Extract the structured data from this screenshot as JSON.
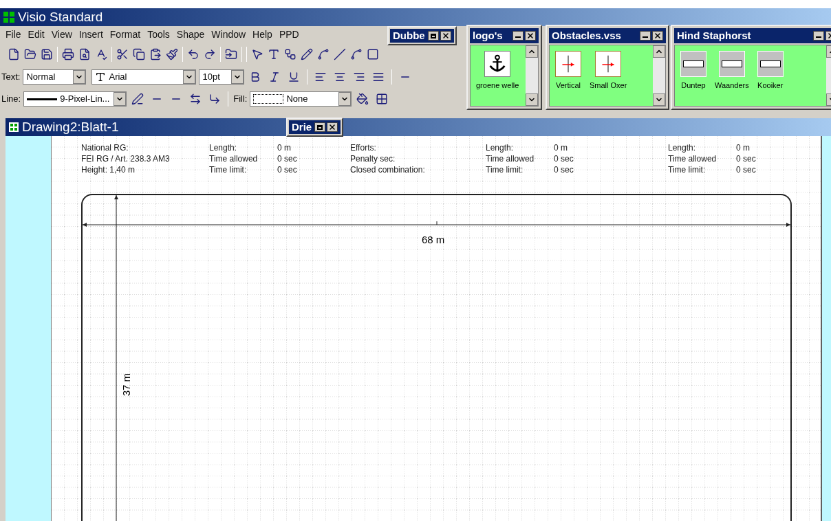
{
  "app": {
    "title": "Visio Standard"
  },
  "menu": [
    "File",
    "Edit",
    "View",
    "Insert",
    "Format",
    "Tools",
    "Shape",
    "Window",
    "Help",
    "PPD"
  ],
  "text_toolbar": {
    "label": "Text:",
    "style": "Normal",
    "font": "Arial",
    "size": "10pt"
  },
  "line_toolbar": {
    "label": "Line:",
    "line": "9-Pixel-Lin...",
    "fill_label": "Fill:",
    "fill": "None"
  },
  "floating": [
    {
      "title": "Dubbe"
    },
    {
      "title": "Drie"
    }
  ],
  "stencils": [
    {
      "title": "logo's",
      "kind": "logo",
      "items": [
        "groene welle"
      ]
    },
    {
      "title": "Obstacles.vss",
      "kind": "obstacle",
      "items": [
        "Vertical",
        "Small Oxer"
      ]
    },
    {
      "title": "Hind Staphorst",
      "kind": "sponsor",
      "items": [
        "Duntep",
        "Waanders",
        "Kooiker"
      ]
    }
  ],
  "drawing": {
    "title": "Drawing2:Blatt-1",
    "info": [
      {
        "kind": "text",
        "lines": [
          "National RG:",
          "FEI RG / Art. 238.3 AM3",
          "Height: 1,40 m"
        ]
      },
      {
        "kind": "pairs",
        "lines": [
          [
            "Length:",
            "0 m"
          ],
          [
            "Time allowed",
            "0 sec"
          ],
          [
            "Time limit:",
            "0 sec"
          ]
        ]
      },
      {
        "kind": "text",
        "lines": [
          "Efforts:",
          "Penalty sec:",
          "Closed combination:"
        ]
      },
      {
        "kind": "pairs",
        "lines": [
          [
            "Length:",
            "0 m"
          ],
          [
            "Time allowed",
            "0 sec"
          ],
          [
            "Time limit:",
            "0 sec"
          ]
        ]
      },
      {
        "kind": "pairs",
        "lines": [
          [
            "Length:",
            "0 m"
          ],
          [
            "Time allowed",
            "0 sec"
          ],
          [
            "Time limit:",
            "0 sec"
          ]
        ]
      }
    ],
    "width_label": "68 m",
    "height_label": "37 m"
  }
}
